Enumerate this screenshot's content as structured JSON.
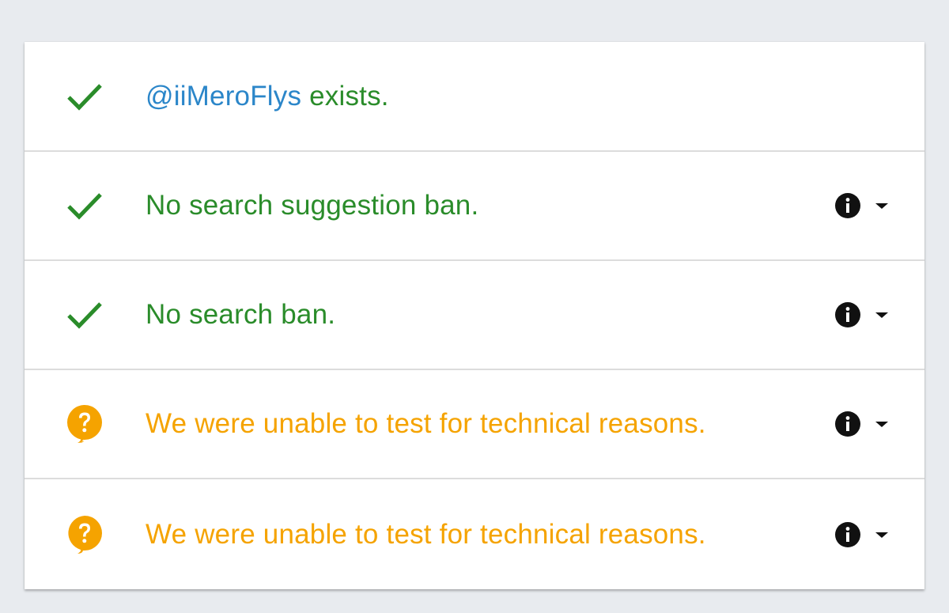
{
  "colors": {
    "success": "#2a8c2a",
    "warning": "#f5a300",
    "handle": "#2b86c9",
    "icon": "#111111"
  },
  "results": [
    {
      "status": "success",
      "icon": "check-icon",
      "handle": "@iiMeroFlys",
      "text": " exists.",
      "has_controls": false
    },
    {
      "status": "success",
      "icon": "check-icon",
      "handle": "",
      "text": "No search suggestion ban.",
      "has_controls": true,
      "info_icon": "info-icon",
      "expand_icon": "caret-down-icon"
    },
    {
      "status": "success",
      "icon": "check-icon",
      "handle": "",
      "text": "No search ban.",
      "has_controls": true,
      "info_icon": "info-icon",
      "expand_icon": "caret-down-icon"
    },
    {
      "status": "warning",
      "icon": "question-bubble-icon",
      "handle": "",
      "text": "We were unable to test for technical reasons.",
      "has_controls": true,
      "info_icon": "info-icon",
      "expand_icon": "caret-down-icon"
    },
    {
      "status": "warning",
      "icon": "question-bubble-icon",
      "handle": "",
      "text": "We were unable to test for technical reasons.",
      "has_controls": true,
      "info_icon": "info-icon",
      "expand_icon": "caret-down-icon"
    }
  ]
}
